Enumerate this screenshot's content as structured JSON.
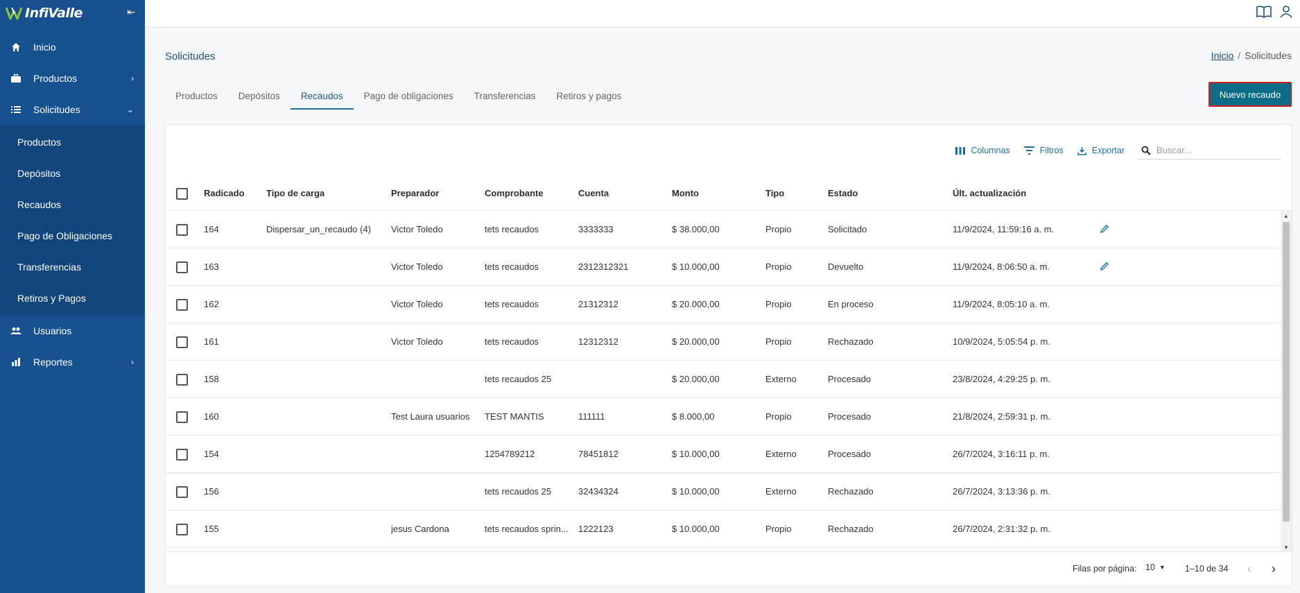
{
  "brand": {
    "name": "InfiValle"
  },
  "sidebar": {
    "collapse_glyph": "⇤",
    "items": [
      {
        "label": "Inicio",
        "icon": "home-icon"
      },
      {
        "label": "Productos",
        "icon": "briefcase-icon"
      },
      {
        "label": "Solicitudes",
        "icon": "list-icon"
      },
      {
        "label": "Usuarios",
        "icon": "users-icon"
      },
      {
        "label": "Reportes",
        "icon": "chart-icon"
      }
    ],
    "subitems": [
      "Productos",
      "Depósitos",
      "Recaudos",
      "Pago de Obligaciones",
      "Transferencias",
      "Retiros y Pagos"
    ]
  },
  "header": {
    "title": "Solicitudes",
    "breadcrumb": {
      "home": "Inicio",
      "separator": "/",
      "current": "Solicitudes"
    }
  },
  "tabs": [
    "Productos",
    "Depósitos",
    "Recaudos",
    "Pago de obligaciones",
    "Transferencias",
    "Retiros y pagos"
  ],
  "active_tab": "Recaudos",
  "new_button": "Nuevo recaudo",
  "toolbar": {
    "columns": "Columnas",
    "filters": "Filtros",
    "export": "Exportar",
    "search_placeholder": "Buscar..."
  },
  "table": {
    "headers": [
      "Radicado",
      "Tipo de carga",
      "Preparador",
      "Comprobante",
      "Cuenta",
      "Monto",
      "Tipo",
      "Estado",
      "Últ. actualización"
    ],
    "rows": [
      {
        "radicado": "164",
        "tipo_carga": "Dispersar_un_recaudo (4) (...",
        "preparador": "Victor Toledo",
        "comprobante": "tets recaudos",
        "cuenta": "3333333",
        "monto": "$ 38.000,00",
        "tipo": "Propio",
        "estado": "Solicitado",
        "actualizacion": "11/9/2024, 11:59:16 a. m.",
        "editable": true
      },
      {
        "radicado": "163",
        "tipo_carga": "",
        "preparador": "Victor Toledo",
        "comprobante": "tets recaudos",
        "cuenta": "2312312321",
        "monto": "$ 10.000,00",
        "tipo": "Propio",
        "estado": "Devuelto",
        "actualizacion": "11/9/2024, 8:06:50 a. m.",
        "editable": true
      },
      {
        "radicado": "162",
        "tipo_carga": "",
        "preparador": "Victor Toledo",
        "comprobante": "tets recaudos",
        "cuenta": "21312312",
        "monto": "$ 20.000,00",
        "tipo": "Propio",
        "estado": "En proceso",
        "actualizacion": "11/9/2024, 8:05:10 a. m.",
        "editable": false
      },
      {
        "radicado": "161",
        "tipo_carga": "",
        "preparador": "Victor Toledo",
        "comprobante": "tets recaudos",
        "cuenta": "12312312",
        "monto": "$ 20.000,00",
        "tipo": "Propio",
        "estado": "Rechazado",
        "actualizacion": "10/9/2024, 5:05:54 p. m.",
        "editable": false
      },
      {
        "radicado": "158",
        "tipo_carga": "",
        "preparador": "",
        "comprobante": "tets recaudos 25",
        "cuenta": "",
        "monto": "$ 20.000,00",
        "tipo": "Externo",
        "estado": "Procesado",
        "actualizacion": "23/8/2024, 4:29:25 p. m.",
        "editable": false
      },
      {
        "radicado": "160",
        "tipo_carga": "",
        "preparador": "Test Laura usuarios",
        "comprobante": "TEST MANTIS",
        "cuenta": "111111",
        "monto": "$ 8.000,00",
        "tipo": "Propio",
        "estado": "Procesado",
        "actualizacion": "21/8/2024, 2:59:31 p. m.",
        "editable": false
      },
      {
        "radicado": "154",
        "tipo_carga": "",
        "preparador": "",
        "comprobante": "1254789212",
        "cuenta": "78451812",
        "monto": "$ 10.000,00",
        "tipo": "Externo",
        "estado": "Procesado",
        "actualizacion": "26/7/2024, 3:16:11 p. m.",
        "editable": false
      },
      {
        "radicado": "156",
        "tipo_carga": "",
        "preparador": "",
        "comprobante": "tets recaudos 25",
        "cuenta": "32434324",
        "monto": "$ 10.000,00",
        "tipo": "Externo",
        "estado": "Rechazado",
        "actualizacion": "26/7/2024, 3:13:36 p. m.",
        "editable": false
      },
      {
        "radicado": "155",
        "tipo_carga": "",
        "preparador": "jesus Cardona",
        "comprobante": "tets recaudos sprin...",
        "cuenta": "1222123",
        "monto": "$ 10.000,00",
        "tipo": "Propio",
        "estado": "Rechazado",
        "actualizacion": "26/7/2024, 2:31:32 p. m.",
        "editable": false
      },
      {
        "radicado": "",
        "tipo_carga": "",
        "preparador": "",
        "comprobante": "",
        "cuenta": "",
        "monto": "",
        "tipo": "",
        "estado": "",
        "actualizacion": "",
        "editable": false
      }
    ]
  },
  "pagination": {
    "rows_per_page_label": "Filas por página:",
    "rows_per_page": "10",
    "range": "1–10 de 34"
  },
  "colors": {
    "sidebar": "#17508e",
    "submenu": "#12457c",
    "accent": "#0d6c87",
    "highlight_border": "#d21a1a"
  }
}
